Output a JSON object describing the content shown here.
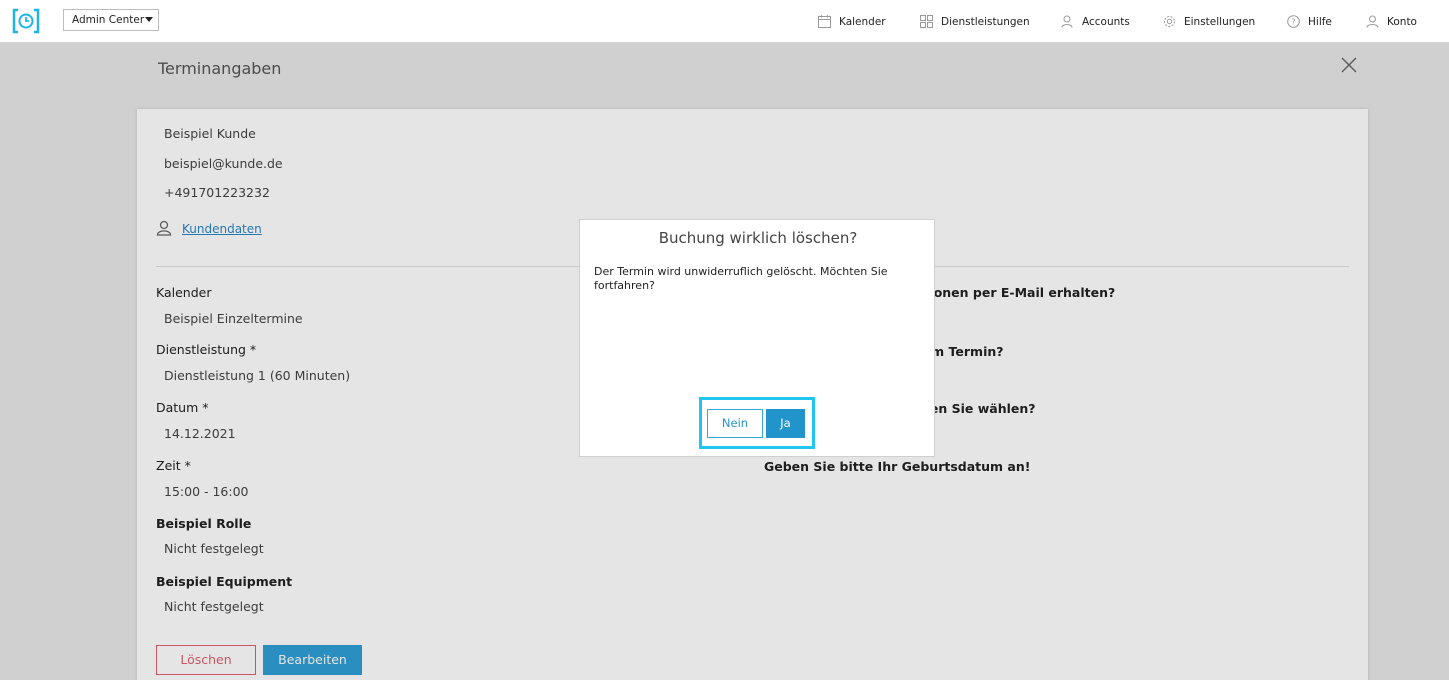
{
  "header": {
    "admin_select": "Admin Center",
    "nav": [
      {
        "label": "Kalender",
        "icon": "calendar-icon"
      },
      {
        "label": "Dienstleistungen",
        "icon": "grid-icon"
      },
      {
        "label": "Accounts",
        "icon": "users-icon"
      },
      {
        "label": "Einstellungen",
        "icon": "gear-icon"
      },
      {
        "label": "Hilfe",
        "icon": "help-icon"
      },
      {
        "label": "Konto",
        "icon": "user-icon"
      }
    ]
  },
  "panel": {
    "title": "Terminangaben",
    "customer": {
      "name": "Beispiel Kunde",
      "email": "beispiel@kunde.de",
      "phone": "+491701223232",
      "link_label": "Kundendaten"
    },
    "fields": [
      {
        "label": "Kalender",
        "value": "Beispiel Einzeltermine"
      },
      {
        "label": "Dienstleistung *",
        "value": "Dienstleistung 1 (60 Minuten)"
      },
      {
        "label": "Datum *",
        "value": "14.12.2021"
      },
      {
        "label": "Zeit *",
        "value": "15:00 - 16:00"
      },
      {
        "label": "Beispiel Rolle",
        "value": "Nicht festgelegt"
      },
      {
        "label": "Beispiel Equipment",
        "value": "Nicht festgelegt"
      }
    ],
    "right_questions": [
      "ationen per E-Mail erhalten?",
      "zum Termin?",
      "hten Sie wählen?",
      "Geben Sie bitte Ihr Geburtsdatum an!"
    ],
    "delete_label": "Löschen",
    "edit_label": "Bearbeiten"
  },
  "modal": {
    "title": "Buchung wirklich löschen?",
    "body": "Der Termin wird unwiderruflich gelöscht. Möchten Sie fortfahren?",
    "no_label": "Nein",
    "yes_label": "Ja"
  },
  "colors": {
    "accent": "#2f9fd6",
    "danger": "#e0606f",
    "highlight": "#1fc6ef"
  }
}
